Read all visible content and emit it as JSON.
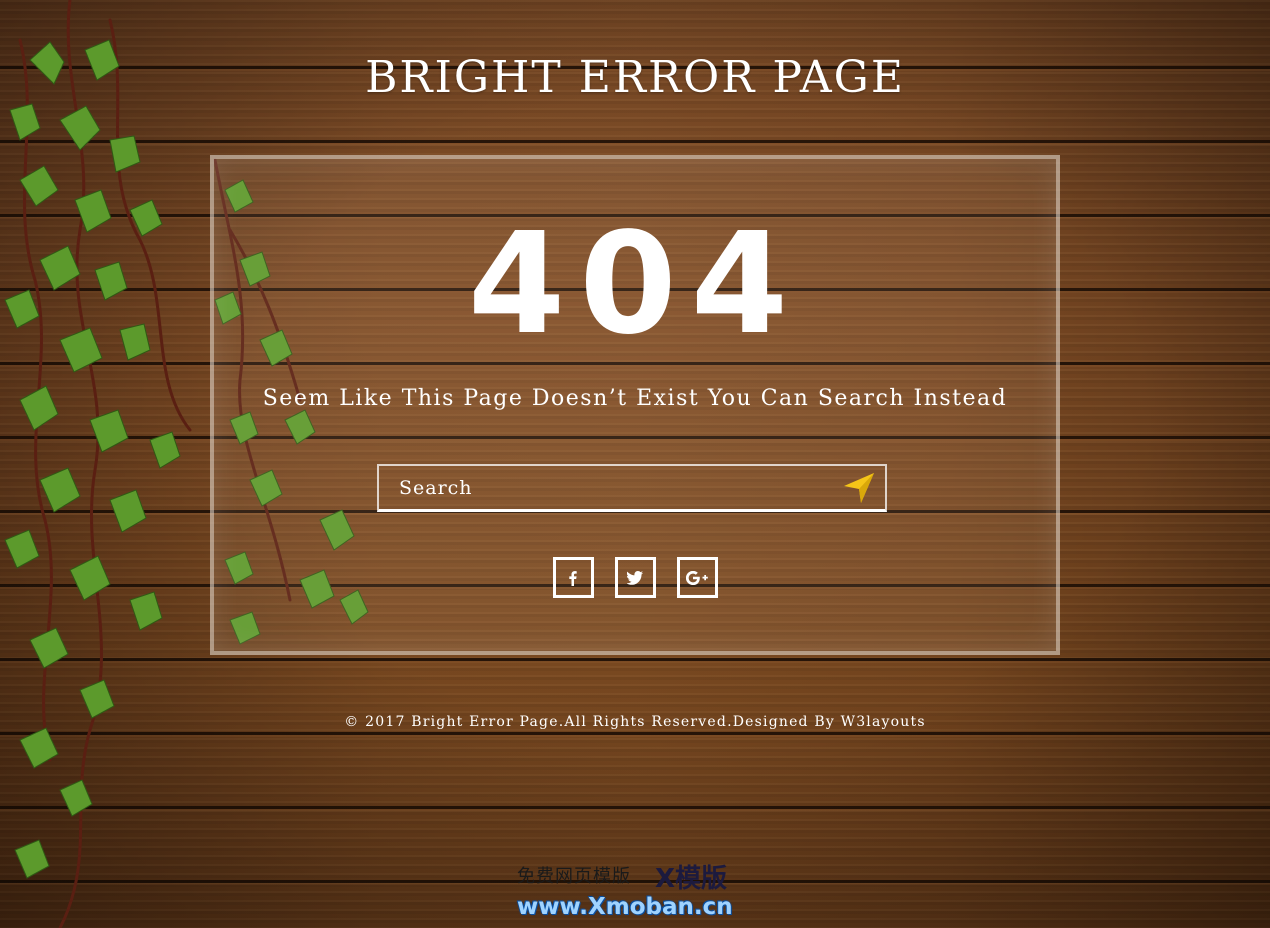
{
  "page": {
    "title": "BRIGHT ERROR PAGE"
  },
  "error": {
    "code": "404",
    "message": "Seem Like This Page Doesn’t Exist You Can Search Instead"
  },
  "search": {
    "placeholder": "Search",
    "value": "",
    "button_icon": "paper-plane-icon",
    "button_icon_color": "#f5c518"
  },
  "social": [
    {
      "name": "facebook",
      "glyph": "f",
      "icon": "facebook-icon"
    },
    {
      "name": "twitter",
      "glyph": "🐦",
      "icon": "twitter-icon"
    },
    {
      "name": "google-plus",
      "glyph": "G+",
      "icon": "google-plus-icon"
    }
  ],
  "footer": {
    "text": "© 2017 Bright Error Page.All Rights Reserved.Designed By W3layouts"
  },
  "watermark": {
    "chinese": "免费网页模版",
    "brand": "X模版",
    "url": "www.Xmoban.cn"
  },
  "colors": {
    "wood": "#6e4323",
    "text": "#ffffff",
    "accent": "#f5c518"
  }
}
